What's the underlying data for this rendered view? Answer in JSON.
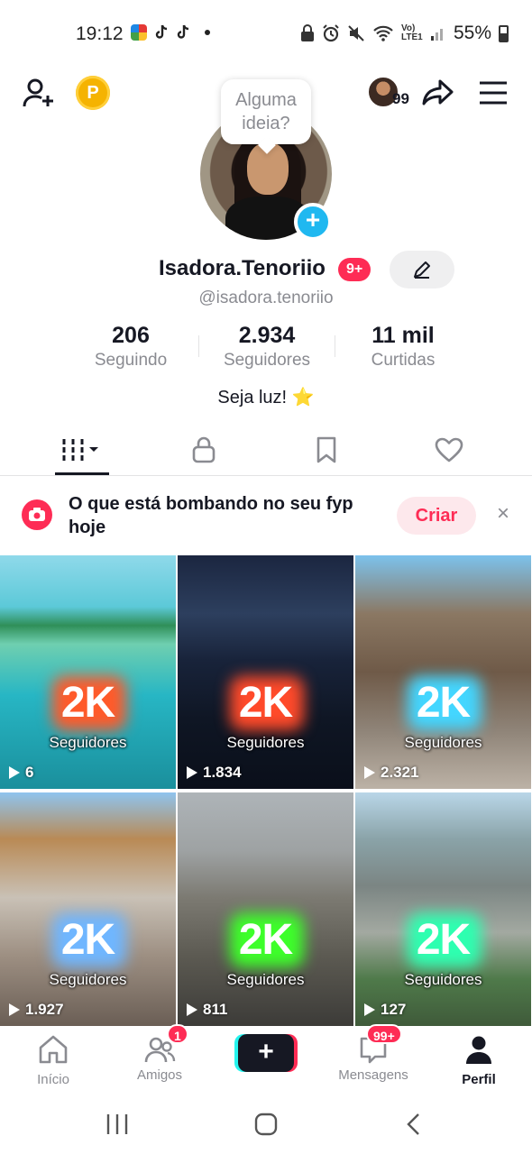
{
  "status_bar": {
    "time": "19:12",
    "left_icons": [
      "news-app-icon",
      "tiktok-icon",
      "tiktok-icon",
      "dot-icon"
    ],
    "right_icons": [
      "lock-icon",
      "alarm-icon",
      "mute-icon",
      "wifi-icon",
      "lte-icon",
      "signal-icon"
    ],
    "lte_label": "Vo) LTE1",
    "battery": "55%"
  },
  "header": {
    "coin_label": "P",
    "visitors_count": "99",
    "idea_bubble": "Alguma ideia?"
  },
  "profile": {
    "display_name": "Isadora.Tenoriio",
    "name_badge": "9+",
    "handle": "@isadora.tenoriio",
    "bio": "Seja luz! ⭐",
    "stats": [
      {
        "value": "206",
        "label": "Seguindo"
      },
      {
        "value": "2.934",
        "label": "Seguidores"
      },
      {
        "value": "11 mil",
        "label": "Curtidas"
      }
    ]
  },
  "tabs": [
    "videos-grid-icon",
    "lock-icon",
    "bookmark-icon",
    "heart-icon"
  ],
  "banner": {
    "text": "O que está bombando no seu fyp hoje",
    "create_label": "Criar",
    "close_label": "×"
  },
  "videos": [
    {
      "big_text": "2K",
      "caption": "Seguidores",
      "views": "6",
      "glow": "#ff5a2a"
    },
    {
      "big_text": "2K",
      "caption": "Seguidores",
      "views": "1.834",
      "glow": "#ff4a2a"
    },
    {
      "big_text": "2K",
      "caption": "Seguidores",
      "views": "2.321",
      "glow": "#43d6ff"
    },
    {
      "big_text": "2K",
      "caption": "Seguidores",
      "views": "1.927",
      "glow": "#6fb6ff"
    },
    {
      "big_text": "2K",
      "caption": "Seguidores",
      "views": "811",
      "glow": "#3dff2a"
    },
    {
      "big_text": "2K",
      "caption": "Seguidores",
      "views": "127",
      "glow": "#2dffb0"
    }
  ],
  "bottom_nav": [
    {
      "label": "Início",
      "icon": "home-icon",
      "active": false
    },
    {
      "label": "Amigos",
      "icon": "friends-icon",
      "badge": "1",
      "active": false
    },
    {
      "label": "+",
      "icon": "create-icon",
      "active": false
    },
    {
      "label": "Mensagens",
      "icon": "inbox-icon",
      "badge": "99+",
      "active": false
    },
    {
      "label": "Perfil",
      "icon": "profile-icon",
      "active": true
    }
  ],
  "colors": {
    "accent": "#fe2c55",
    "text": "#161823",
    "secondary": "#8a8b91",
    "plus_badge": "#20b8f0",
    "coin": "#f5b301"
  }
}
